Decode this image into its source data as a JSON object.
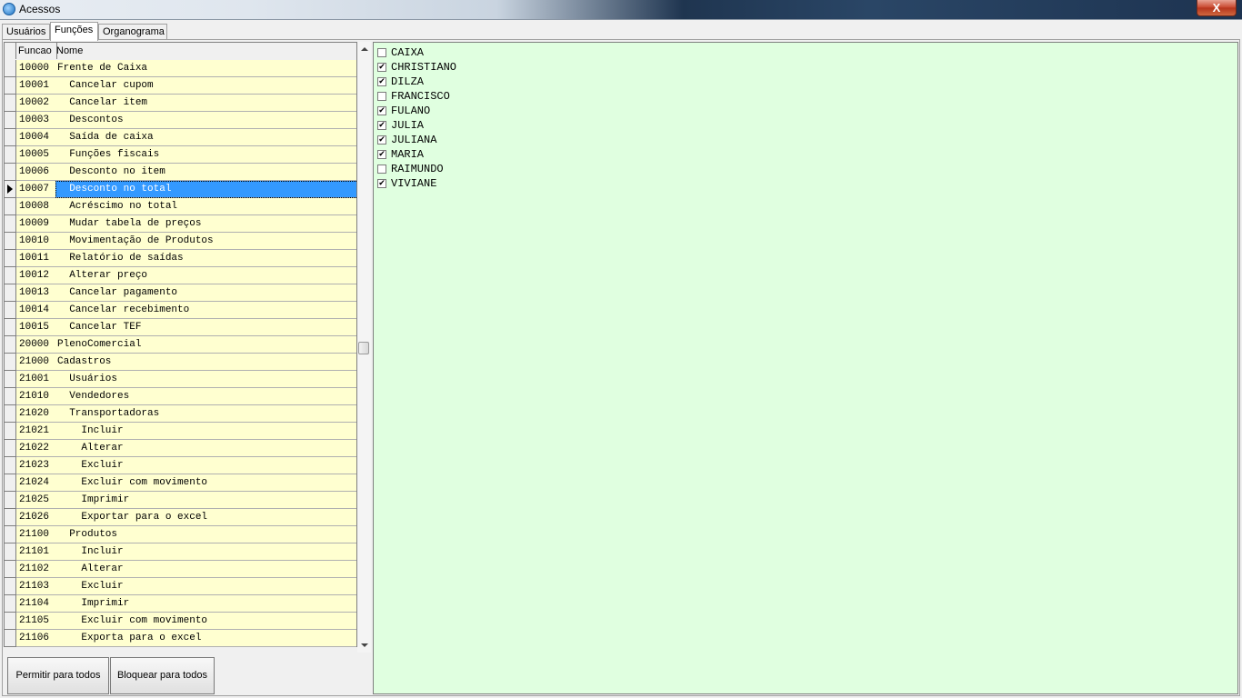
{
  "window": {
    "title": "Acessos",
    "close_glyph": "X"
  },
  "tabs": [
    "Usuários",
    "Funções",
    "Organograma"
  ],
  "grid": {
    "columns": [
      "Funcao",
      "Nome"
    ],
    "rows": [
      {
        "code": "10000",
        "name": "Frente de Caixa"
      },
      {
        "code": "10001",
        "name": "  Cancelar cupom"
      },
      {
        "code": "10002",
        "name": "  Cancelar item"
      },
      {
        "code": "10003",
        "name": "  Descontos"
      },
      {
        "code": "10004",
        "name": "  Saída de caixa"
      },
      {
        "code": "10005",
        "name": "  Funções fiscais"
      },
      {
        "code": "10006",
        "name": "  Desconto no item"
      },
      {
        "code": "10007",
        "name": "  Desconto no total"
      },
      {
        "code": "10008",
        "name": "  Acréscimo no total"
      },
      {
        "code": "10009",
        "name": "  Mudar tabela de preços"
      },
      {
        "code": "10010",
        "name": "  Movimentação de Produtos"
      },
      {
        "code": "10011",
        "name": "  Relatório de saídas"
      },
      {
        "code": "10012",
        "name": "  Alterar preço"
      },
      {
        "code": "10013",
        "name": "  Cancelar pagamento"
      },
      {
        "code": "10014",
        "name": "  Cancelar recebimento"
      },
      {
        "code": "10015",
        "name": "  Cancelar TEF"
      },
      {
        "code": "20000",
        "name": "PlenoComercial"
      },
      {
        "code": "21000",
        "name": "Cadastros"
      },
      {
        "code": "21001",
        "name": "  Usuários"
      },
      {
        "code": "21010",
        "name": "  Vendedores"
      },
      {
        "code": "21020",
        "name": "  Transportadoras"
      },
      {
        "code": "21021",
        "name": "    Incluir"
      },
      {
        "code": "21022",
        "name": "    Alterar"
      },
      {
        "code": "21023",
        "name": "    Excluir"
      },
      {
        "code": "21024",
        "name": "    Excluir com movimento"
      },
      {
        "code": "21025",
        "name": "    Imprimir"
      },
      {
        "code": "21026",
        "name": "    Exportar para o excel"
      },
      {
        "code": "21100",
        "name": "  Produtos"
      },
      {
        "code": "21101",
        "name": "    Incluir"
      },
      {
        "code": "21102",
        "name": "    Alterar"
      },
      {
        "code": "21103",
        "name": "    Excluir"
      },
      {
        "code": "21104",
        "name": "    Imprimir"
      },
      {
        "code": "21105",
        "name": "    Excluir com movimento"
      },
      {
        "code": "21106",
        "name": "    Exporta para o excel"
      }
    ],
    "selected_code": "10007"
  },
  "buttons": {
    "allow_all": "Permitir para todos",
    "block_all": "Bloquear para todos"
  },
  "users": [
    {
      "name": "CAIXA",
      "checked": false
    },
    {
      "name": "CHRISTIANO",
      "checked": true
    },
    {
      "name": "DILZA",
      "checked": true
    },
    {
      "name": "FRANCISCO",
      "checked": false
    },
    {
      "name": "FULANO",
      "checked": true
    },
    {
      "name": "JULIA",
      "checked": true
    },
    {
      "name": "JULIANA",
      "checked": true
    },
    {
      "name": "MARIA",
      "checked": true
    },
    {
      "name": "RAIMUNDO",
      "checked": false
    },
    {
      "name": "VIVIANE",
      "checked": true
    }
  ],
  "colors": {
    "grid_cell_bg": "#ffffd0",
    "selection": "#3399ff",
    "users_bg": "#e0ffe0"
  }
}
